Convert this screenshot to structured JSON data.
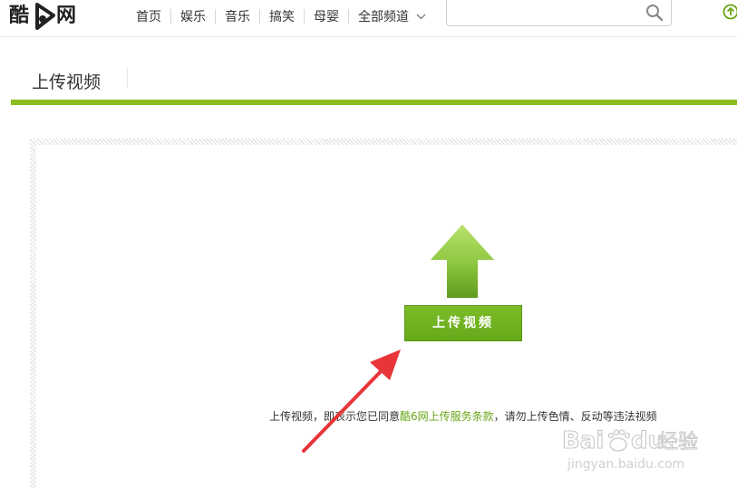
{
  "logo": {
    "left_char": "酷",
    "right_char": "网"
  },
  "nav": {
    "items": [
      "首页",
      "娱乐",
      "音乐",
      "搞笑",
      "母婴",
      "全部频道"
    ]
  },
  "search": {
    "value": "",
    "placeholder": ""
  },
  "page": {
    "title": "上传视频"
  },
  "upload": {
    "button_label": "上传视频",
    "notice_prefix": "上传视频，即表示您已同意",
    "notice_link": "酷6网上传服务条款",
    "notice_suffix": "，请勿上传色情、反动等违法视频"
  },
  "watermark": {
    "brand": "Bai",
    "brand_du": "du",
    "cn": "经验",
    "url": "jingyan.baidu.com"
  },
  "colors": {
    "accent_green": "#8cbd1f",
    "button_green": "#6fb320",
    "link_green": "#6aa516",
    "annotation_red": "#e8353a"
  }
}
